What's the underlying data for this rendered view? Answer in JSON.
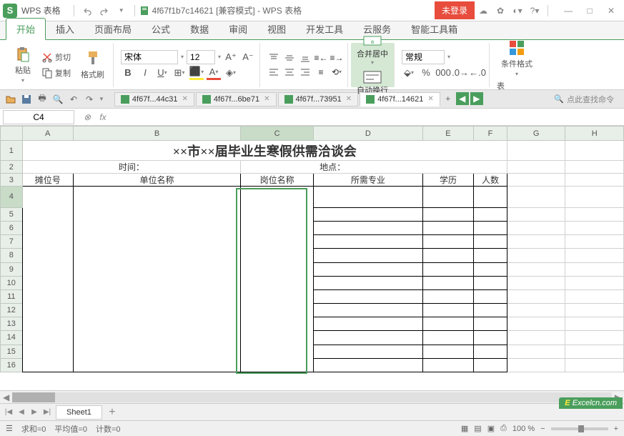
{
  "app": {
    "logo": "S",
    "name": "WPS 表格",
    "doc_title": "4f67f1b7c14621 [兼容模式] - WPS 表格",
    "login": "未登录"
  },
  "menu": {
    "tabs": [
      "开始",
      "插入",
      "页面布局",
      "公式",
      "数据",
      "审阅",
      "视图",
      "开发工具",
      "云服务",
      "智能工具箱"
    ]
  },
  "ribbon": {
    "paste": "粘贴",
    "cut": "剪切",
    "copy": "复制",
    "format_painter": "格式刷",
    "font_name": "宋体",
    "font_size": "12",
    "merge_center": "合并居中",
    "wrap_text": "自动换行",
    "number_format": "常规",
    "cond_format": "条件格式",
    "table_last": "表"
  },
  "doctabs": {
    "t1": "4f67f...44c31",
    "t2": "4f67f...6be71",
    "t3": "4f67f...73951",
    "t4": "4f67f...14621",
    "search_placeholder": "点此查找命令"
  },
  "formula": {
    "cell_ref": "C4",
    "fx": "fx",
    "value": ""
  },
  "sheet": {
    "cols": [
      "A",
      "B",
      "C",
      "D",
      "E",
      "F",
      "G",
      "H"
    ],
    "rows": [
      "1",
      "2",
      "3",
      "4",
      "5",
      "6",
      "7",
      "8",
      "9",
      "10",
      "11",
      "12",
      "13",
      "14",
      "15",
      "16"
    ],
    "title": "××市××届毕业生寒假供需洽谈会",
    "time_label": "时间：",
    "place_label": "地点：",
    "headers": {
      "a": "摊位号",
      "b": "单位名称",
      "c": "岗位名称",
      "d": "所需专业",
      "e": "学历",
      "f": "人数"
    },
    "tab_name": "Sheet1"
  },
  "status": {
    "sum": "求和=0",
    "avg": "平均值=0",
    "count": "计数=0",
    "zoom": "100 %"
  },
  "watermark": "Excelcn.com"
}
